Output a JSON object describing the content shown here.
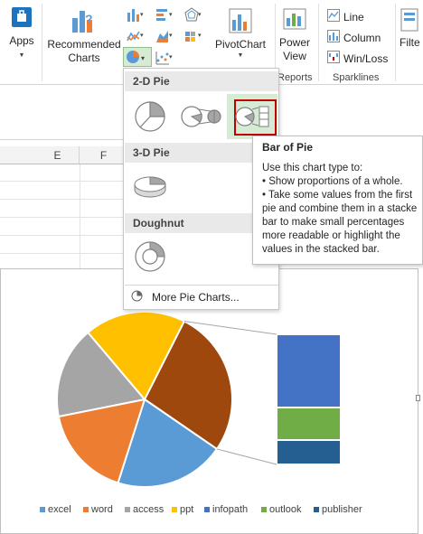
{
  "ribbon": {
    "apps_label": "Apps",
    "recommended_label_1": "Recommended",
    "recommended_label_2": "Charts",
    "pivotchart_label": "PivotChart",
    "power_view_label_1": "Power",
    "power_view_label_2": "View",
    "reports_group": "Reports",
    "sparklines": {
      "line": "Line",
      "column": "Column",
      "winloss": "Win/Loss",
      "group": "Sparklines"
    },
    "filter_label": "Filte"
  },
  "sheet": {
    "columns": [
      "E",
      "F"
    ]
  },
  "dropdown": {
    "section_2d": "2-D Pie",
    "section_3d": "3-D Pie",
    "section_doughnut": "Doughnut",
    "more_label": "More Pie Charts..."
  },
  "tooltip": {
    "title": "Bar of Pie",
    "lines": [
      "Use this chart type to:",
      "• Show proportions of a whole.",
      "• Take some values from the first",
      "pie and combine them in a stacke",
      "bar to make small percentages",
      "more readable or highlight the",
      "values in the stacked bar."
    ]
  },
  "chart_data": {
    "type": "pie",
    "subtype": "bar-of-pie",
    "categories": [
      "excel",
      "word",
      "access",
      "ppt",
      "infopath",
      "outlook",
      "publisher"
    ],
    "values": [
      24,
      20,
      20,
      22,
      18,
      8,
      6
    ],
    "colors": [
      "#5b9bd5",
      "#ed7d31",
      "#a5a5a5",
      "#ffc000",
      "#4472c4",
      "#70ad47",
      "#255e91"
    ],
    "pie_slices": [
      "infopath-combined",
      "excel",
      "word",
      "access",
      "ppt"
    ],
    "bar_stack": [
      "infopath",
      "outlook",
      "publisher"
    ],
    "legend_position": "bottom"
  },
  "colors": {
    "accent_green": "#217346",
    "selection_border": "#c00000",
    "selected_tile": "#d6ebd4"
  }
}
